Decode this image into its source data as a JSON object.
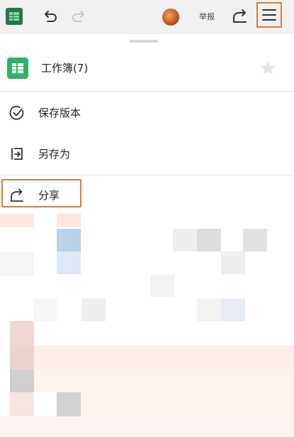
{
  "toolbar": {
    "app_icon": "spreadsheet-icon",
    "undo_icon": "undo-icon",
    "redo_icon": "redo-icon",
    "report_label": "举报",
    "share_icon": "share-icon",
    "menu_icon": "hamburger-menu-icon"
  },
  "menu": {
    "workbook_title": "工作簿(7)",
    "star_icon": "star-icon",
    "items": [
      {
        "icon": "check-circle-icon",
        "label": "保存版本"
      },
      {
        "icon": "save-as-icon",
        "label": "另存为"
      },
      {
        "icon": "share-icon",
        "label": "分享"
      }
    ]
  },
  "colors": {
    "highlight": "#e07a3a",
    "sheet_green": "#2fb36a",
    "toolbar_bg": "#f1f1f1"
  }
}
